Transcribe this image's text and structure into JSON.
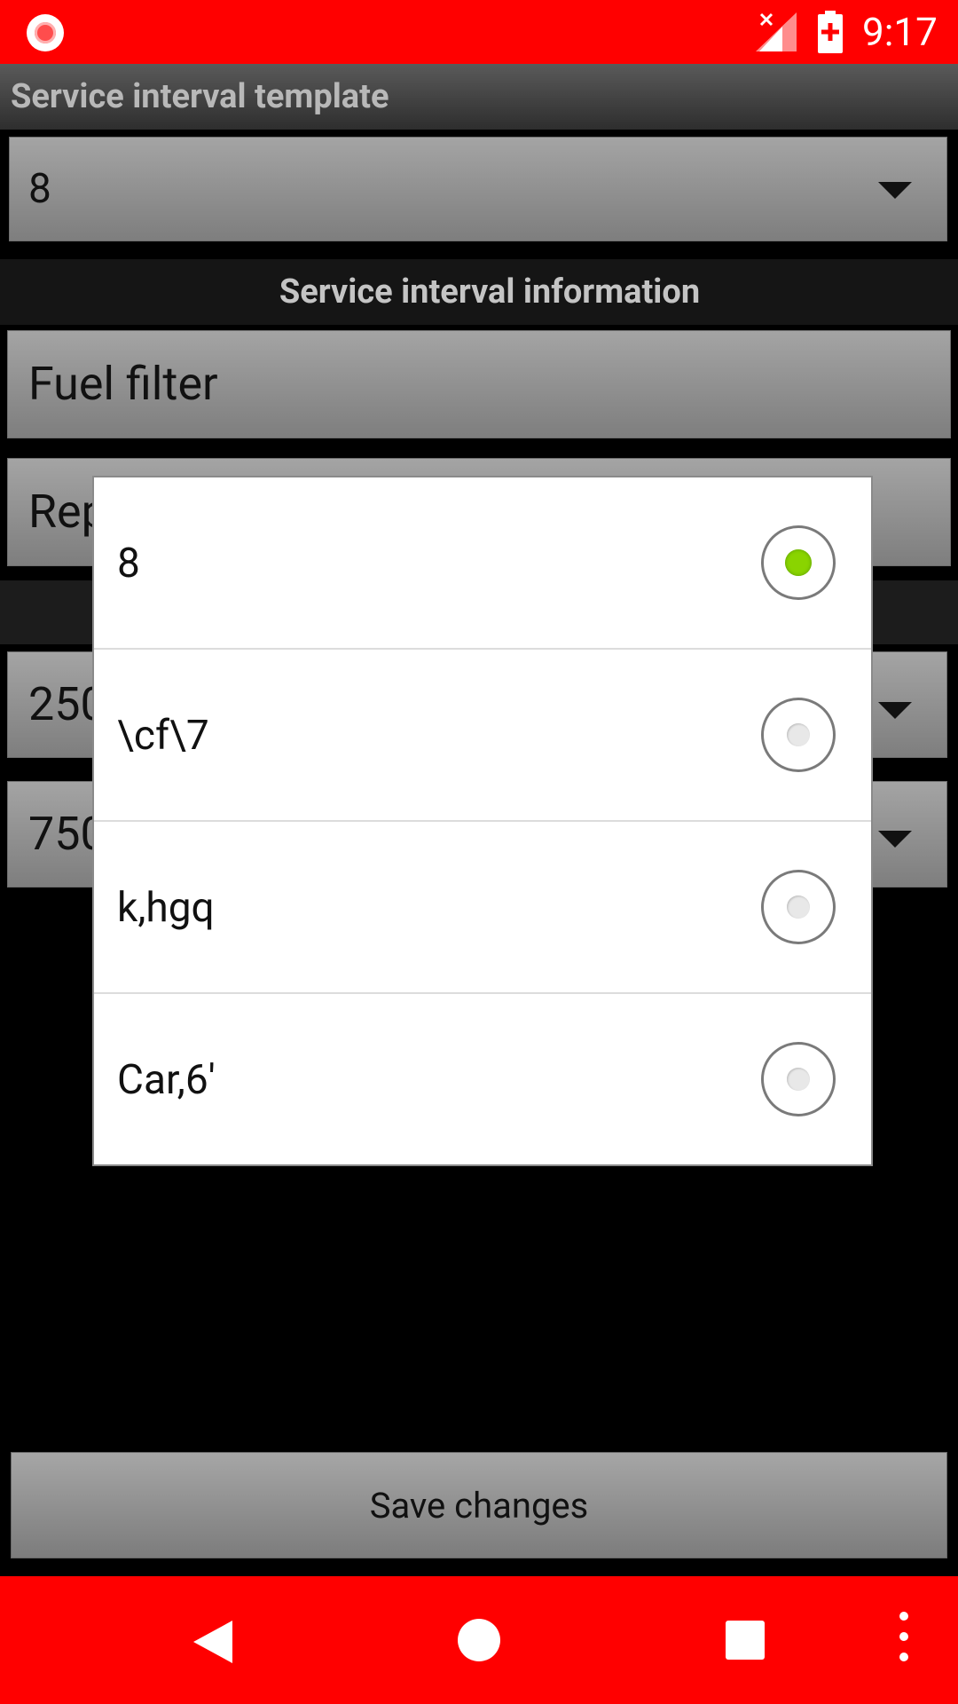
{
  "status_bar": {
    "time": "9:17",
    "icons": [
      "record-indicator-icon",
      "no-signal-icon",
      "battery-charging-icon"
    ]
  },
  "form": {
    "template_section_title": "Service interval template",
    "template_value": "8",
    "info_section_title": "Service interval information",
    "name_value": "Fuel filter",
    "action_value_visible": "Rep",
    "km_value_visible": "250",
    "months_value_visible": "750",
    "save_label": "Save changes"
  },
  "dialog": {
    "options": [
      {
        "label": "8",
        "checked": true
      },
      {
        "label": "\\cf\\7",
        "checked": false
      },
      {
        "label": "k,hgq",
        "checked": false
      },
      {
        "label": "Car,6'",
        "checked": false
      }
    ]
  },
  "colors": {
    "status_bar": "#ff0000",
    "nav_bar": "#ff0000",
    "radio_checked": "#8ad400"
  },
  "nav_bar": {
    "icons": [
      "back-icon",
      "home-icon",
      "recents-icon",
      "more-icon"
    ]
  }
}
